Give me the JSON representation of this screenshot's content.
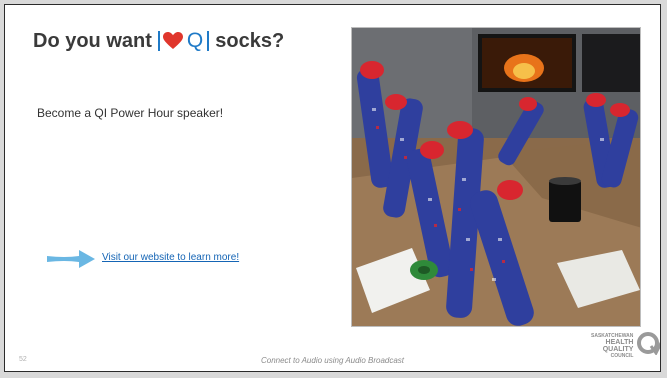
{
  "slide": {
    "title_before": "Do you want",
    "logo_letters": "Q",
    "title_after": "socks?",
    "subtitle": "Become a QI Power Hour speaker!",
    "link_text": "Visit our website to learn more!",
    "footer_text": "Connect to Audio using Audio Broadcast",
    "slide_number": "52",
    "photo_description_icon": "socks-meeting-photo"
  },
  "hqc_logo": {
    "line1": "SASKATCHEWAN",
    "line2": "HEALTH",
    "line3": "QUALITY",
    "line4": "COUNCIL"
  },
  "colors": {
    "heart": "#e0362c",
    "accent_blue": "#1f7ac7",
    "link": "#1565b5",
    "arrow": "#6ab7e3",
    "sock_blue": "#2f3f9e",
    "sock_red": "#d8262f"
  }
}
